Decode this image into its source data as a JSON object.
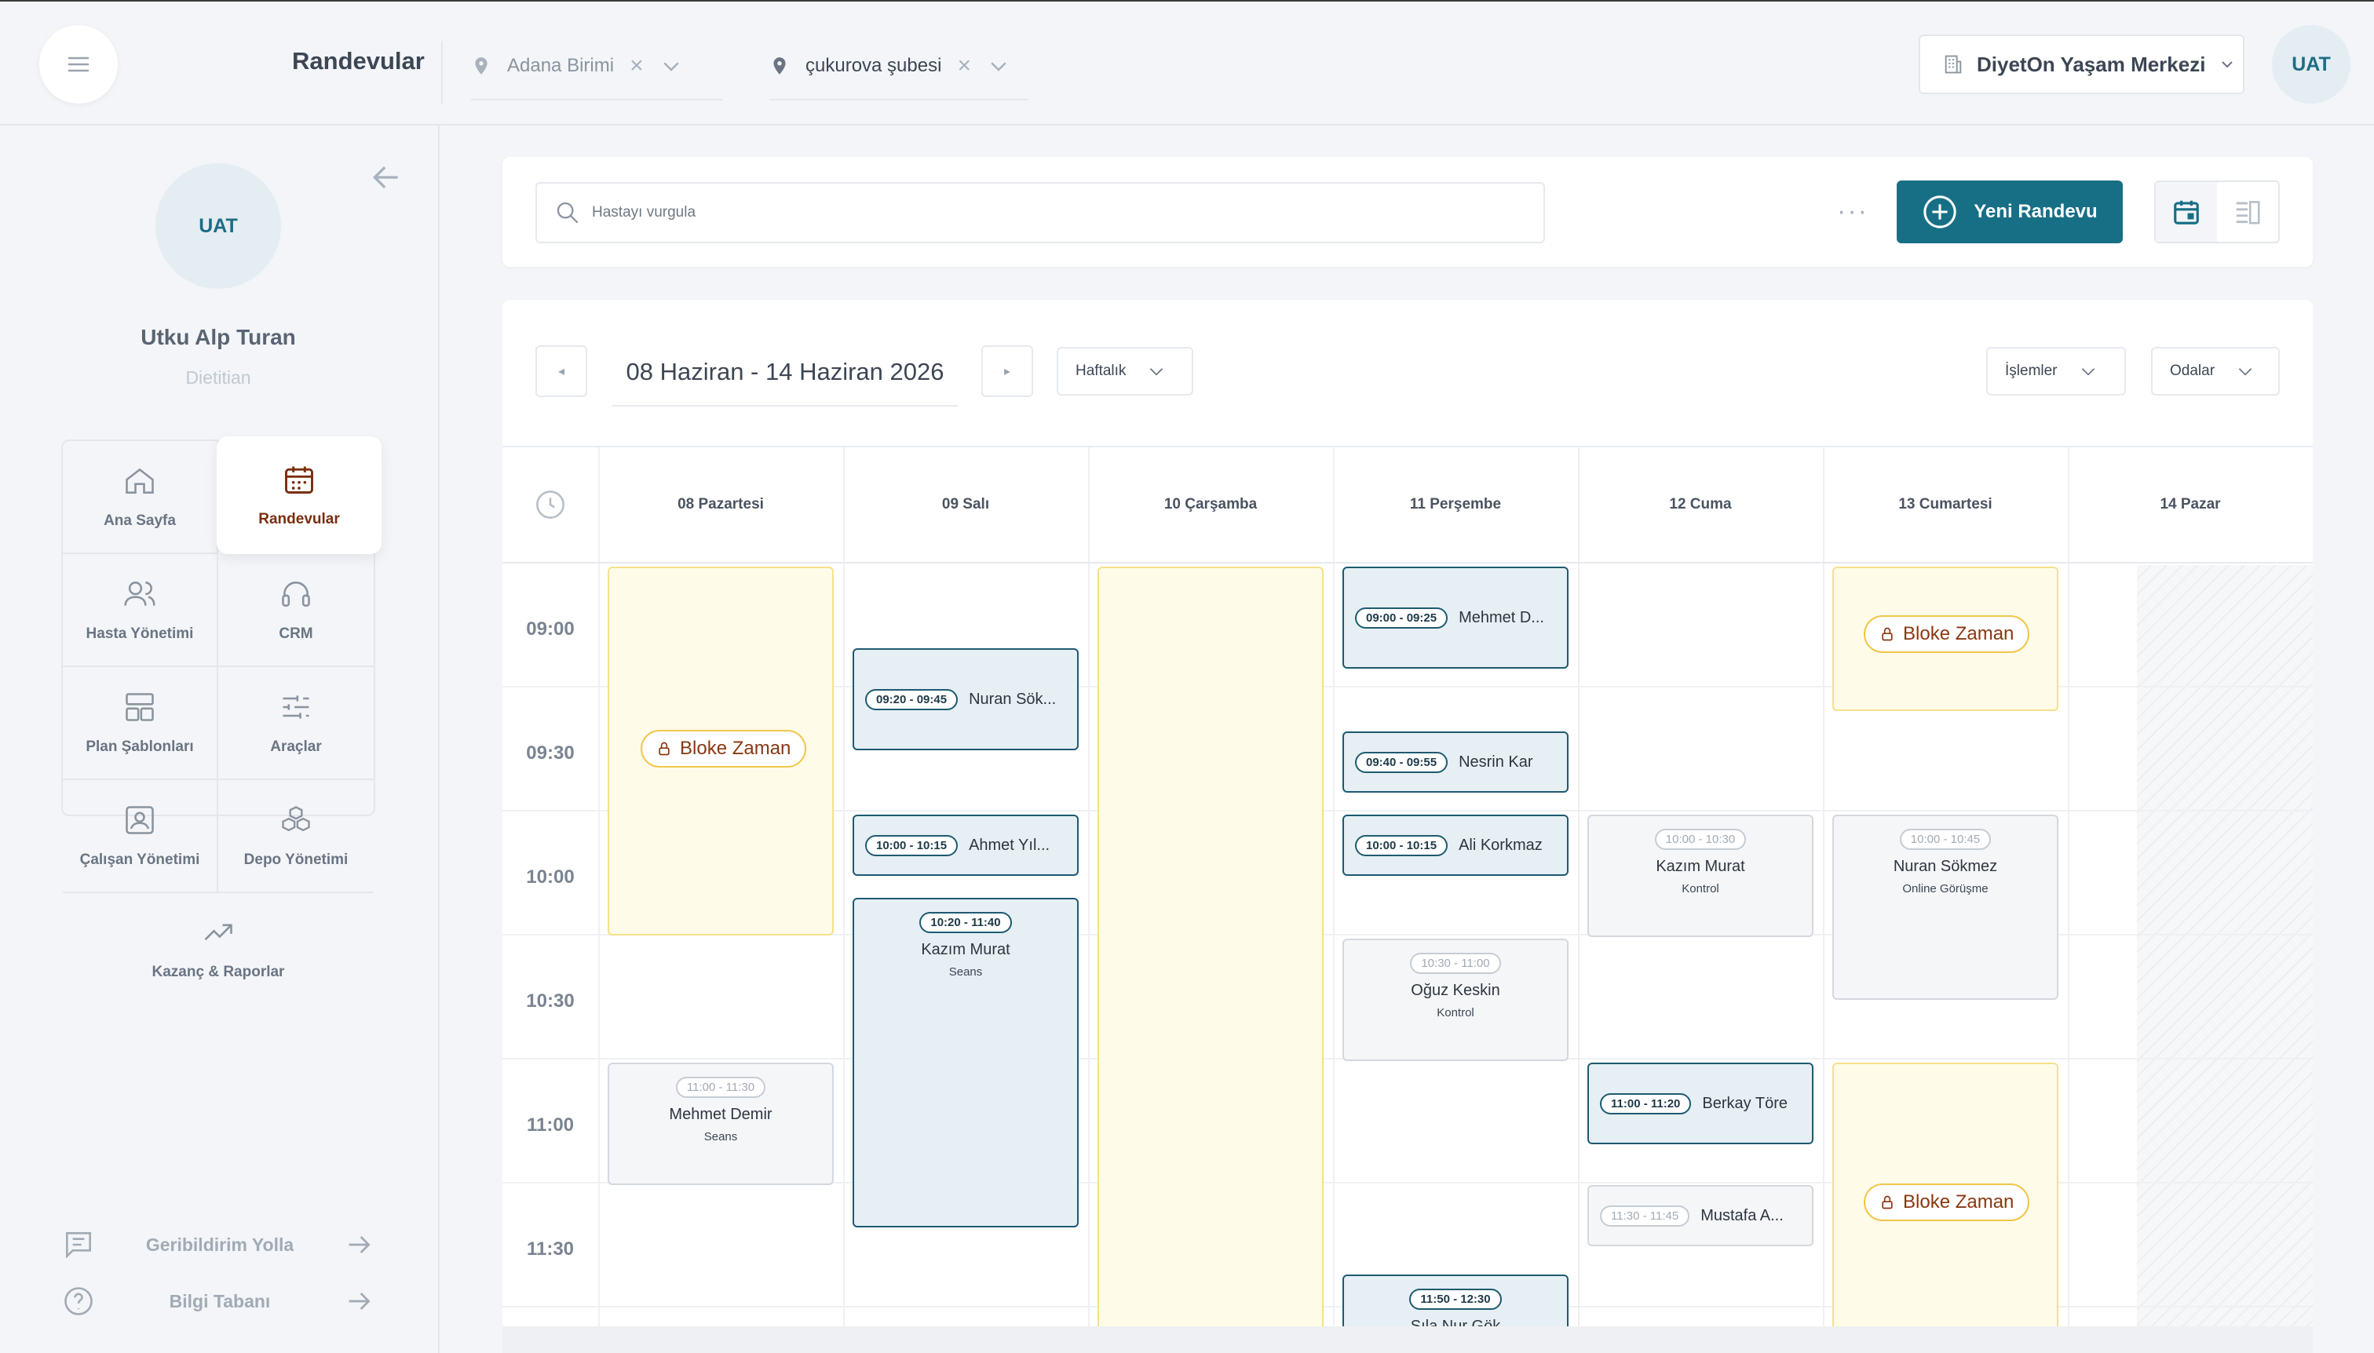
{
  "header": {
    "page_title": "Randevular",
    "unit_filter": "Adana Birimi",
    "branch_filter": "çukurova şubesi",
    "center_select": "DiyetOn Yaşam Merkezi",
    "avatar": "UAT"
  },
  "sidebar": {
    "avatar": "UAT",
    "user_name": "Utku Alp Turan",
    "user_role": "Dietitian",
    "nav": [
      {
        "label": "Ana Sayfa",
        "icon": "home-icon"
      },
      {
        "label": "Randevular",
        "icon": "calendar-icon"
      },
      {
        "label": "Hasta Yönetimi",
        "icon": "users-icon"
      },
      {
        "label": "CRM",
        "icon": "headset-icon"
      },
      {
        "label": "Plan Şablonları",
        "icon": "layout-icon"
      },
      {
        "label": "Araçlar",
        "icon": "sliders-icon"
      },
      {
        "label": "Çalışan Yönetimi",
        "icon": "badge-icon"
      },
      {
        "label": "Depo Yönetimi",
        "icon": "boxes-icon"
      },
      {
        "label": "Kazanç & Raporlar",
        "icon": "trend-icon"
      }
    ],
    "feedback": "Geribildirim Yolla",
    "knowledge_base": "Bilgi Tabanı"
  },
  "toolbar": {
    "search_placeholder": "Hastayı vurgula",
    "new_button": "Yeni Randevu"
  },
  "calendar": {
    "range": "08 Haziran - 14 Haziran 2026",
    "view": "Haftalık",
    "operations": "İşlemler",
    "rooms": "Odalar",
    "days": [
      "08 Pazartesi",
      "09 Salı",
      "10 Çarşamba",
      "11 Perşembe",
      "12 Cuma",
      "13 Cumartesi",
      "14 Pazar"
    ],
    "times": [
      "09:00",
      "09:30",
      "10:00",
      "10:30",
      "11:00",
      "11:30"
    ],
    "block_label": "Bloke Zaman",
    "events": [
      {
        "time": "09:20 - 09:45",
        "name": "Nuran Sök..."
      },
      {
        "time": "10:00 - 10:15",
        "name": "Ahmet Yıl..."
      },
      {
        "time": "10:20 - 11:40",
        "name": "Kazım Murat",
        "type": "Seans"
      },
      {
        "time": "11:00 - 11:30",
        "name": "Mehmet Demir",
        "type": "Seans"
      },
      {
        "time": "09:00 - 09:25",
        "name": "Mehmet D..."
      },
      {
        "time": "09:40 - 09:55",
        "name": "Nesrin Kar"
      },
      {
        "time": "10:00 - 10:15",
        "name": "Ali Korkmaz"
      },
      {
        "time": "10:30 - 11:00",
        "name": "Oğuz Keskin",
        "type": "Kontrol"
      },
      {
        "time": "11:50 - 12:30",
        "name": "Sıla Nur Gök"
      },
      {
        "time": "10:00 - 10:30",
        "name": "Kazım Murat",
        "type": "Kontrol"
      },
      {
        "time": "11:00 - 11:20",
        "name": "Berkay Töre"
      },
      {
        "time": "11:30 - 11:45",
        "name": "Mustafa A..."
      },
      {
        "time": "10:00 - 10:45",
        "name": "Nuran Sökmez",
        "type": "Online Görüşme"
      }
    ]
  }
}
